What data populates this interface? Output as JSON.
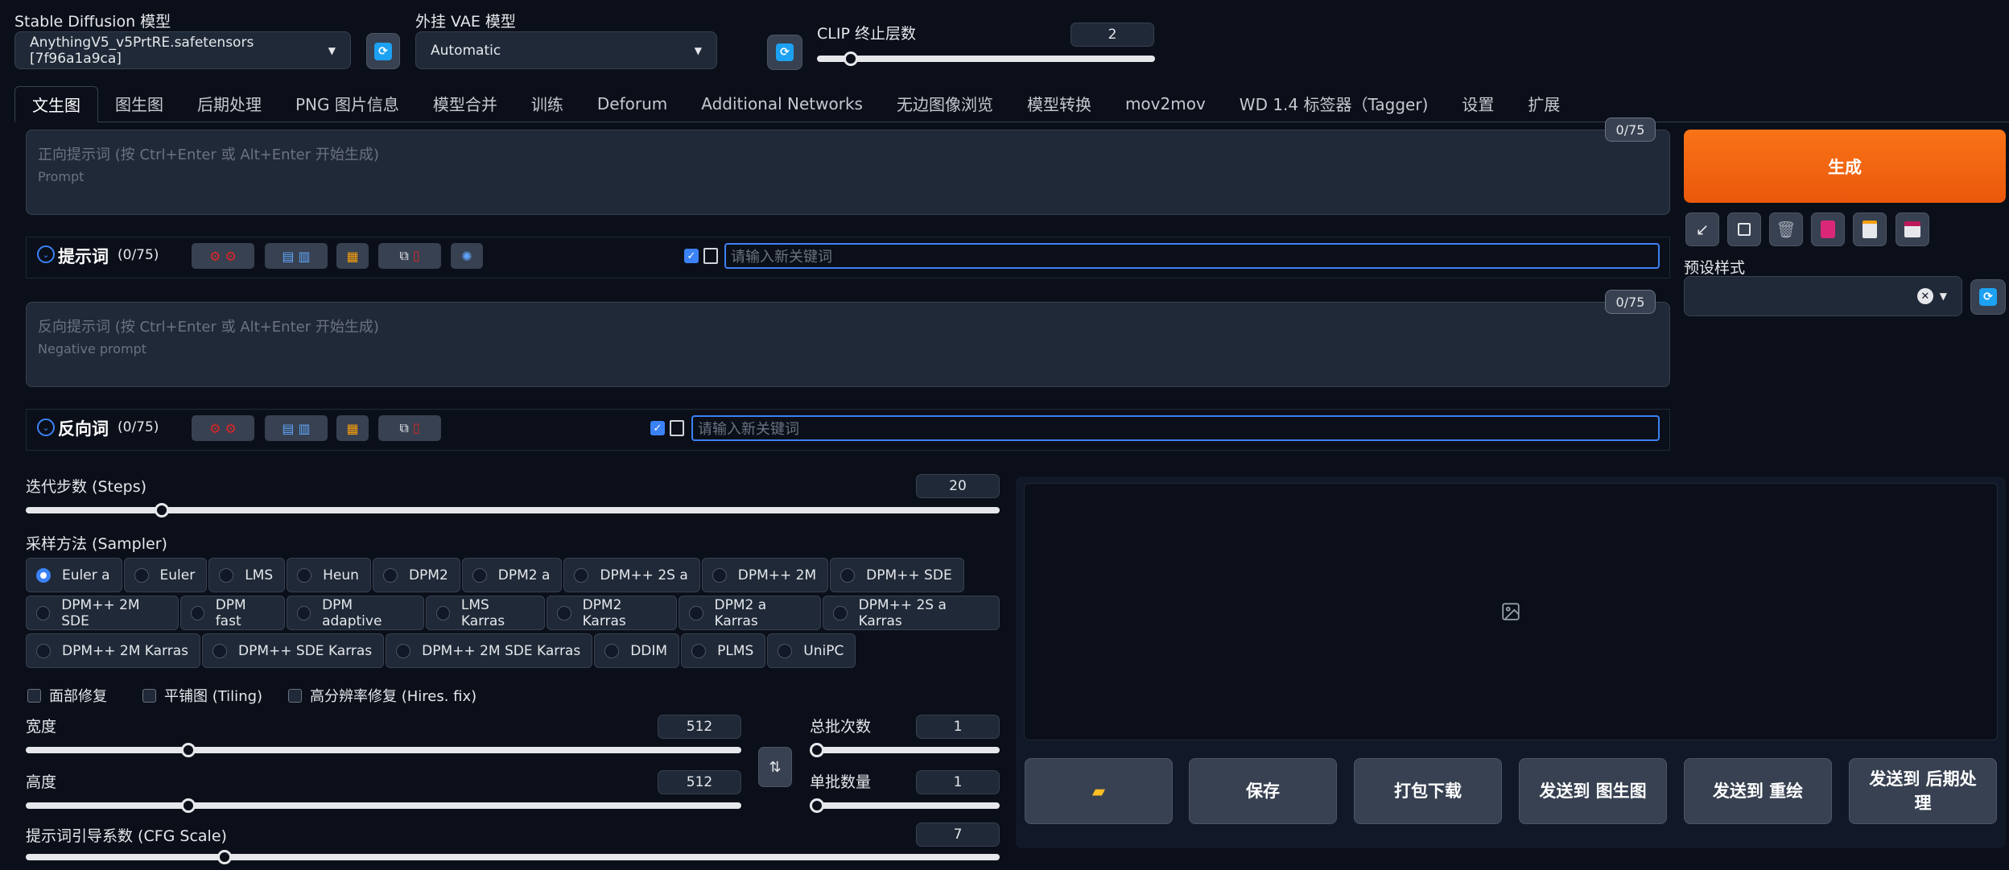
{
  "top": {
    "sd_model_label": "Stable Diffusion 模型",
    "sd_model_value": "AnythingV5_v5PrtRE.safetensors [7f96a1a9ca]",
    "vae_label": "外挂 VAE 模型",
    "vae_value": "Automatic",
    "clip_label": "CLIP 终止层数",
    "clip_value": "2",
    "clip_fraction": 0.083
  },
  "tabs": [
    "文生图",
    "图生图",
    "后期处理",
    "PNG 图片信息",
    "模型合并",
    "训练",
    "Deforum",
    "Additional Networks",
    "无边图像浏览",
    "模型转换",
    "mov2mov",
    "WD 1.4 标签器（Tagger)",
    "设置",
    "扩展"
  ],
  "prompt": {
    "placeholder_line1": "正向提示词 (按 Ctrl+Enter 或 Alt+Enter 开始生成)",
    "placeholder_line2": "Prompt",
    "counter": "0/75",
    "kw_title": "提示词",
    "kw_count": "(0/75)",
    "kw_placeholder": "请输入新关键词"
  },
  "negative": {
    "placeholder_line1": "反向提示词 (按 Ctrl+Enter 或 Alt+Enter 开始生成)",
    "placeholder_line2": "Negative prompt",
    "counter": "0/75",
    "kw_title": "反向词",
    "kw_count": "(0/75)",
    "kw_placeholder": "请输入新关键词"
  },
  "side": {
    "generate_label": "生成",
    "styles_label": "预设样式",
    "tool_icons": [
      "arrow-icon",
      "square-icon",
      "trash-icon",
      "pink-card-icon",
      "clipboard-icon",
      "save-icon"
    ]
  },
  "steps": {
    "label": "迭代步数 (Steps)",
    "value": "20",
    "fraction": 0.134
  },
  "sampler": {
    "label": "采样方法 (Sampler)",
    "selected": "Euler a",
    "rows": [
      [
        "Euler a",
        "Euler",
        "LMS",
        "Heun",
        "DPM2",
        "DPM2 a",
        "DPM++ 2S a",
        "DPM++ 2M",
        "DPM++ SDE"
      ],
      [
        "DPM++ 2M SDE",
        "DPM fast",
        "DPM adaptive",
        "LMS Karras",
        "DPM2 Karras",
        "DPM2 a Karras",
        "DPM++ 2S a Karras"
      ],
      [
        "DPM++ 2M Karras",
        "DPM++ SDE Karras",
        "DPM++ 2M SDE Karras",
        "DDIM",
        "PLMS",
        "UniPC"
      ]
    ]
  },
  "checkboxes": [
    "面部修复",
    "平铺图 (Tiling)",
    "高分辨率修复 (Hires. fix)"
  ],
  "width": {
    "label": "宽度",
    "value": "512",
    "fraction": 0.222
  },
  "height": {
    "label": "高度",
    "value": "512",
    "fraction": 0.222
  },
  "batch_count": {
    "label": "总批次数",
    "value": "1",
    "fraction": 0.0
  },
  "batch_size": {
    "label": "单批数量",
    "value": "1",
    "fraction": 0.0
  },
  "cfg": {
    "label": "提示词引导系数 (CFG Scale)",
    "value": "7",
    "fraction": 0.2
  },
  "actions": {
    "folder_icon": "folder-icon",
    "save": "保存",
    "zip": "打包下载",
    "send_img2img": "发送到 图生图",
    "send_inpaint": "发送到 重绘",
    "send_extras_line1": "发送到 后期处",
    "send_extras_line2": "理"
  },
  "colors": {
    "accent": "#3b82f6",
    "generate": "#ea580c",
    "background": "#0b0f19"
  }
}
